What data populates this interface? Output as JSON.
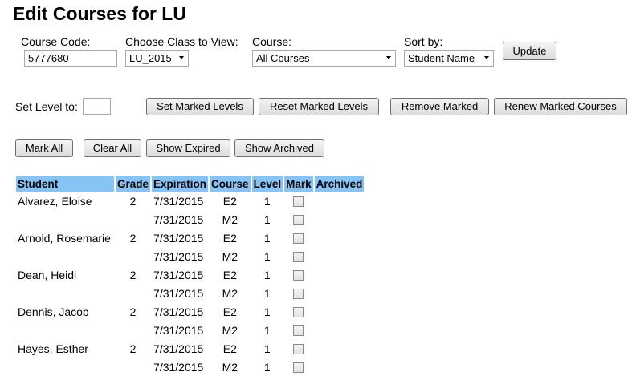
{
  "page": {
    "title": "Edit Courses for LU"
  },
  "filters": {
    "course_code_label": "Course Code:",
    "course_code_value": "5777680",
    "class_label": "Choose Class to View:",
    "class_value": "LU_2015",
    "course_label": "Course:",
    "course_value": "All Courses",
    "sort_label": "Sort by:",
    "sort_value": "Student Name",
    "update_label": "Update"
  },
  "level_controls": {
    "set_level_label": "Set Level to:",
    "set_level_value": "",
    "set_marked_label": "Set Marked Levels",
    "reset_marked_label": "Reset Marked Levels",
    "remove_marked_label": "Remove Marked",
    "renew_marked_label": "Renew Marked Courses"
  },
  "list_controls": {
    "mark_all_label": "Mark All",
    "clear_all_label": "Clear All",
    "show_expired_label": "Show Expired",
    "show_archived_label": "Show Archived"
  },
  "table": {
    "headers": [
      "Student",
      "Grade",
      "Expiration",
      "Course",
      "Level",
      "Mark",
      "Archived"
    ],
    "rows": [
      {
        "student": "Alvarez, Eloise",
        "grade": "2",
        "expiration": "7/31/2015",
        "course": "E2",
        "level": "1",
        "marked": false,
        "archived": ""
      },
      {
        "student": "",
        "grade": "",
        "expiration": "7/31/2015",
        "course": "M2",
        "level": "1",
        "marked": false,
        "archived": ""
      },
      {
        "student": "Arnold, Rosemarie",
        "grade": "2",
        "expiration": "7/31/2015",
        "course": "E2",
        "level": "1",
        "marked": false,
        "archived": ""
      },
      {
        "student": "",
        "grade": "",
        "expiration": "7/31/2015",
        "course": "M2",
        "level": "1",
        "marked": false,
        "archived": ""
      },
      {
        "student": "Dean, Heidi",
        "grade": "2",
        "expiration": "7/31/2015",
        "course": "E2",
        "level": "1",
        "marked": false,
        "archived": ""
      },
      {
        "student": "",
        "grade": "",
        "expiration": "7/31/2015",
        "course": "M2",
        "level": "1",
        "marked": false,
        "archived": ""
      },
      {
        "student": "Dennis, Jacob",
        "grade": "2",
        "expiration": "7/31/2015",
        "course": "E2",
        "level": "1",
        "marked": false,
        "archived": ""
      },
      {
        "student": "",
        "grade": "",
        "expiration": "7/31/2015",
        "course": "M2",
        "level": "1",
        "marked": false,
        "archived": ""
      },
      {
        "student": "Hayes, Esther",
        "grade": "2",
        "expiration": "7/31/2015",
        "course": "E2",
        "level": "1",
        "marked": false,
        "archived": ""
      },
      {
        "student": "",
        "grade": "",
        "expiration": "7/31/2015",
        "course": "M2",
        "level": "1",
        "marked": false,
        "archived": ""
      }
    ]
  },
  "colors": {
    "header_bg": "#87c3f5"
  }
}
